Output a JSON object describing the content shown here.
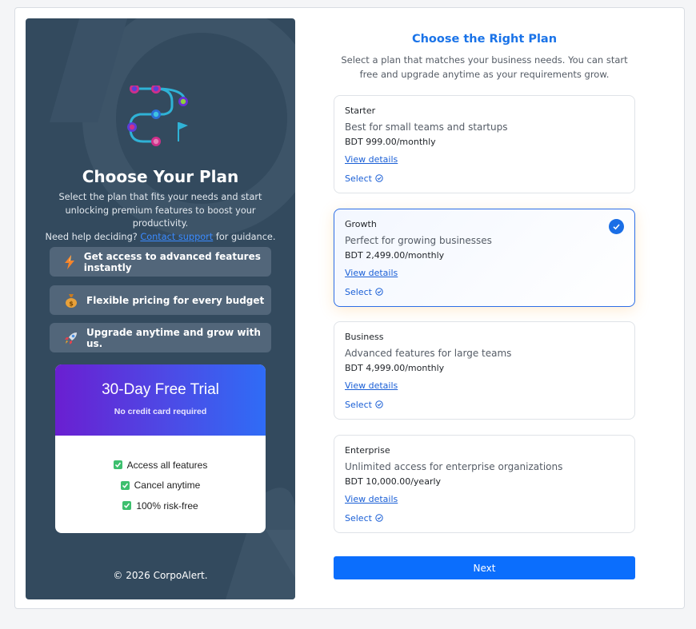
{
  "left": {
    "title": "Choose Your Plan",
    "desc_line1": "Select the plan that fits your needs and start unlocking premium features to boost your productivity.",
    "desc_prefix": "Need help deciding? ",
    "contact_link": "Contact support",
    "desc_suffix": " for guidance.",
    "features": [
      {
        "label": "Get access to advanced features instantly",
        "icon": "lightning-icon"
      },
      {
        "label": "Flexible pricing for every budget",
        "icon": "money-bag-icon"
      },
      {
        "label": "Upgrade anytime and grow with us.",
        "icon": "rocket-icon"
      }
    ],
    "trial": {
      "title": "30-Day Free Trial",
      "subtitle": "No credit card required",
      "items": [
        "Access all features",
        "Cancel anytime",
        "100% risk-free"
      ]
    },
    "copyright": "© 2026 CorpoAlert."
  },
  "right": {
    "title": "Choose the Right Plan",
    "desc": "Select a plan that matches your business needs. You can start free and upgrade anytime as your requirements grow.",
    "plans": [
      {
        "name": "Starter",
        "desc": "Best for small teams and startups",
        "price": "BDT 999.00/monthly",
        "details": "View details",
        "select": "Select",
        "selected": false
      },
      {
        "name": "Growth",
        "desc": "Perfect for growing businesses",
        "price": "BDT 2,499.00/monthly",
        "details": "View details",
        "select": "Select",
        "selected": true
      },
      {
        "name": "Business",
        "desc": "Advanced features for large teams",
        "price": "BDT 4,999.00/monthly",
        "details": "View details",
        "select": "Select",
        "selected": false
      },
      {
        "name": "Enterprise",
        "desc": "Unlimited access for enterprise organizations",
        "price": "BDT 10,000.00/yearly",
        "details": "View details",
        "select": "Select",
        "selected": false
      }
    ],
    "next_label": "Next"
  },
  "colors": {
    "left_bg": "#334a5e",
    "accent": "#1a73e8",
    "next_button": "#0b6efd",
    "check_green": "#3dbf6e"
  }
}
